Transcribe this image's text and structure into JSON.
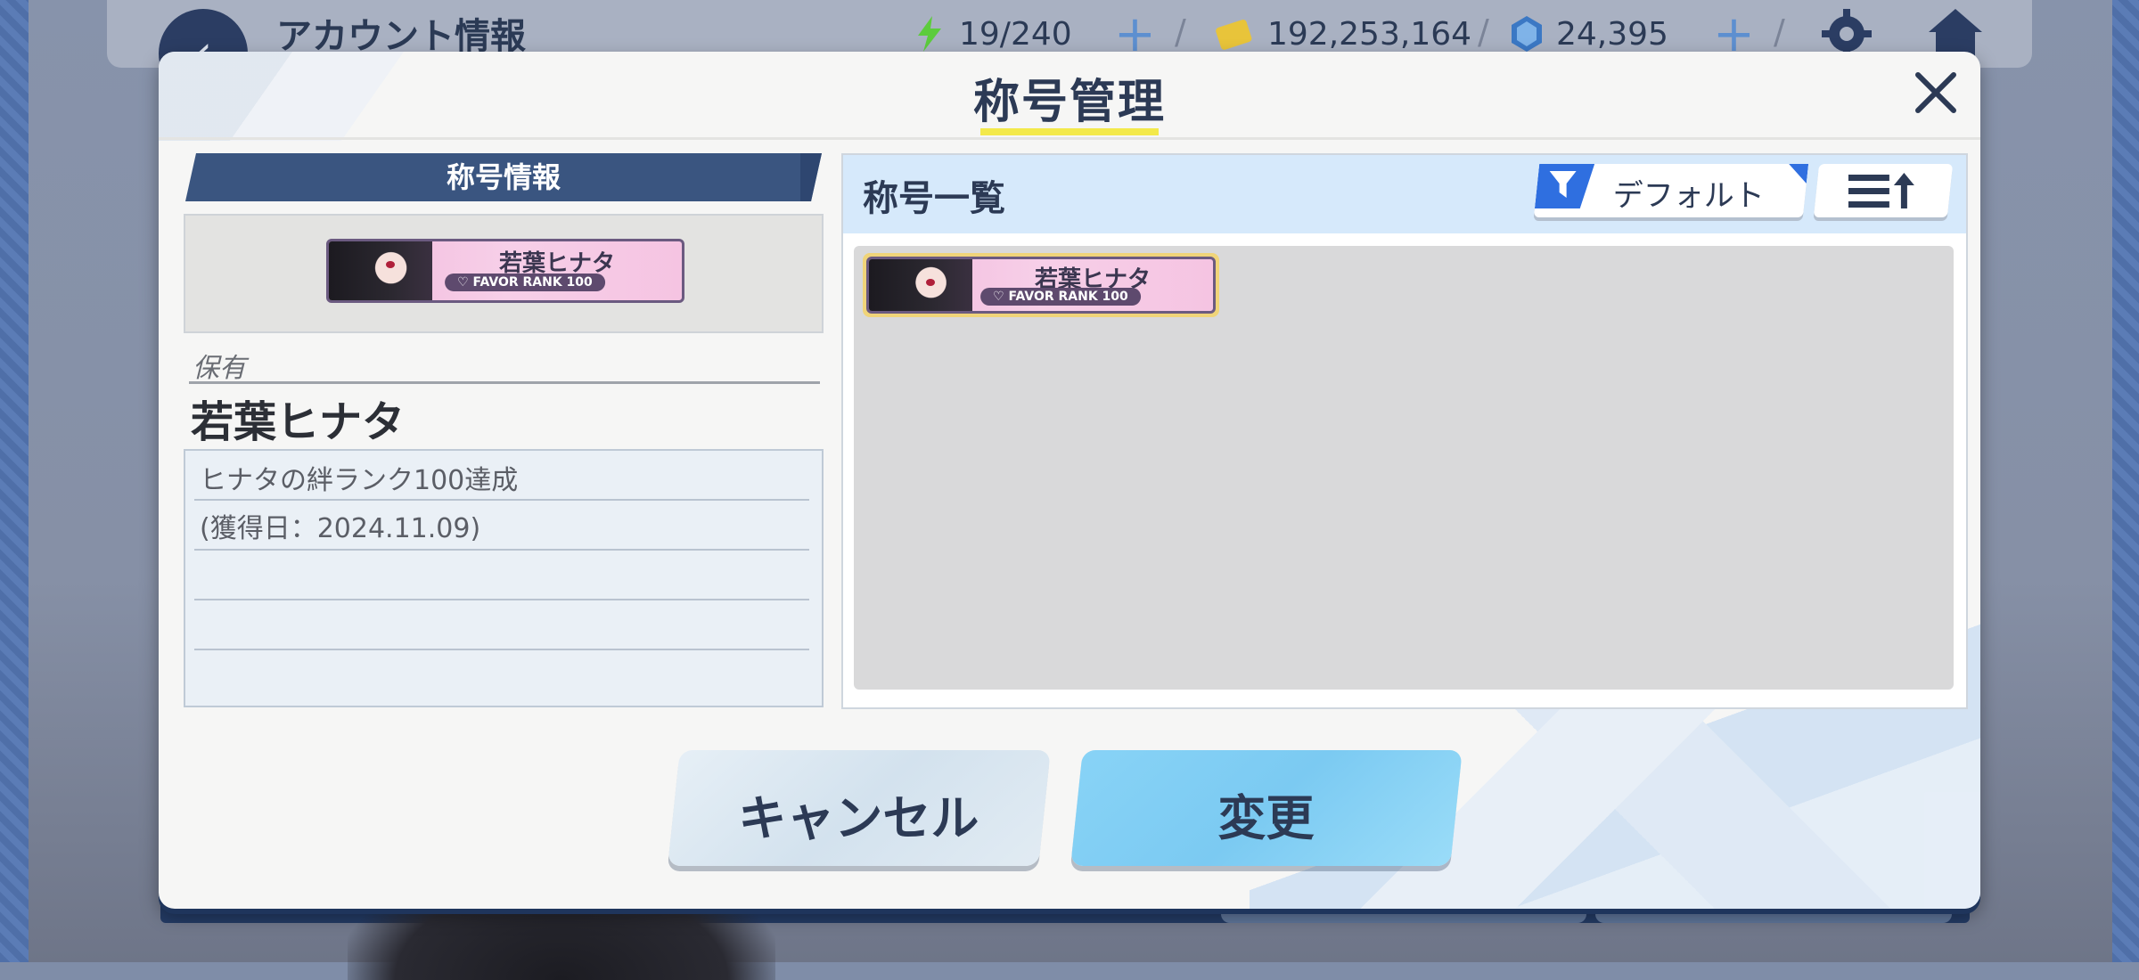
{
  "header": {
    "title": "アカウント情報",
    "stamina": "19/240",
    "credits": "192,253,164",
    "gems": "24,395"
  },
  "modal": {
    "title": "称号管理",
    "left": {
      "section_title": "称号情報",
      "owned_label": "保有",
      "title_name": "若葉ヒナタ",
      "desc_line1": "ヒナタの絆ランク100達成",
      "desc_line2": "(獲得日：2024.11.09)"
    },
    "badge": {
      "name": "若葉ヒナタ",
      "rank": "♡ FAVOR RANK 100"
    },
    "right": {
      "list_title": "称号一覧",
      "filter_label": "デフォルト"
    },
    "buttons": {
      "cancel": "キャンセル",
      "change": "変更"
    }
  },
  "colors": {
    "accent_blue": "#2f6fe0",
    "title_underline": "#f3e94a",
    "change_button": "#88d3f6"
  }
}
